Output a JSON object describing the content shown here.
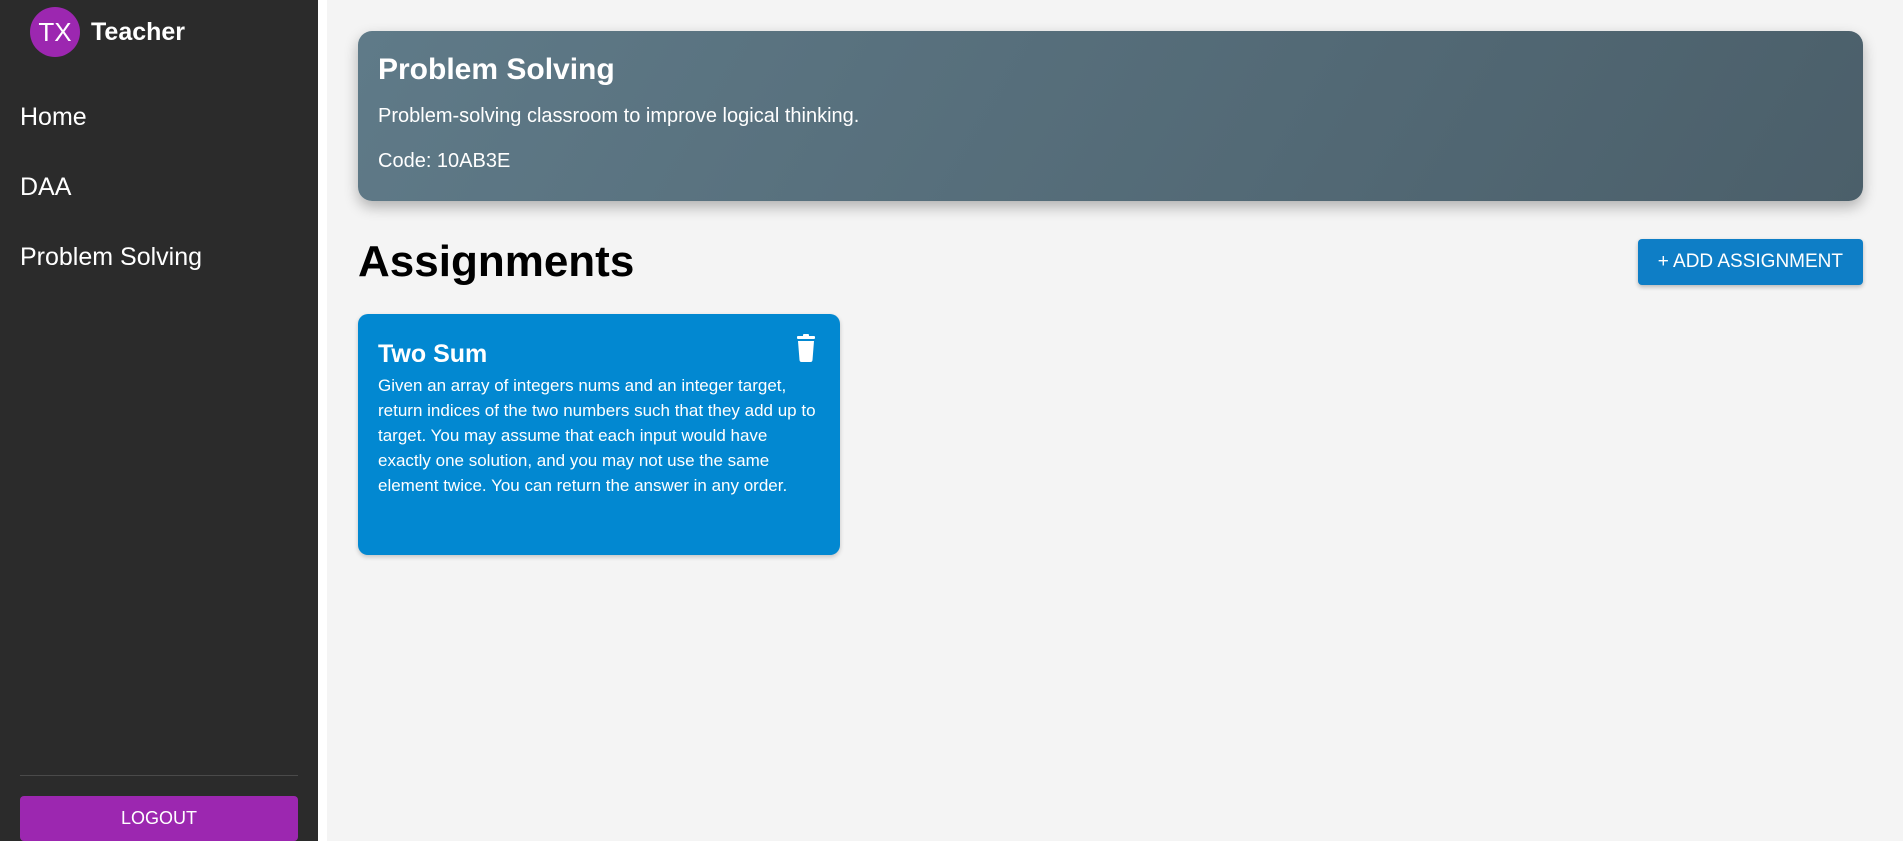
{
  "sidebar": {
    "avatar_initials": "TX",
    "user_name": "Teacher",
    "nav_items": [
      "Home",
      "DAA",
      "Problem Solving"
    ],
    "logout_label": "LOGOUT"
  },
  "classroom": {
    "title": "Problem Solving",
    "description": "Problem-solving classroom to improve logical thinking.",
    "code": "Code: 10AB3E"
  },
  "assignments": {
    "heading": "Assignments",
    "add_button_label": "+ ADD ASSIGNMENT",
    "items": [
      {
        "title": "Two Sum",
        "description": "Given an array of integers nums and an integer target, return indices of the two numbers such that they add up to target. You may assume that each input would have exactly one solution, and you may not use the same element twice. You can return the answer in any order.",
        "icon": "trash-icon"
      }
    ]
  },
  "colors": {
    "sidebar_bg": "#2b2b2b",
    "accent_purple": "#9c27b0",
    "card_blue": "#0288d1",
    "button_blue": "#0e7ec6",
    "banner_gray": "#566f7c"
  }
}
